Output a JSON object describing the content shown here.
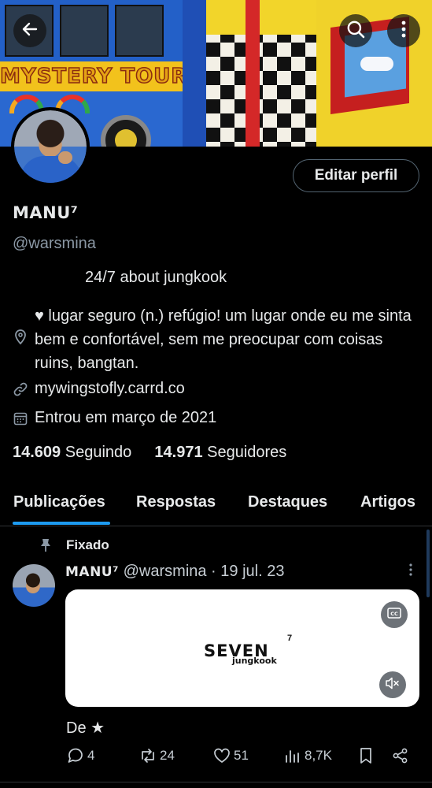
{
  "header": {
    "back_icon": "arrow-left-icon",
    "search_icon": "search-icon",
    "more_icon": "more-vertical-icon",
    "banner_text": "MYSTERY TOUR"
  },
  "profile": {
    "edit_label": "Editar perfil",
    "name": "MANU⁷",
    "handle": "@warsmina",
    "bio_line1": "24/7 about jungkook",
    "bio_line2": "♥ lugar seguro (n.) refúgio! um lugar onde eu me sinta bem e confortável, sem me preocupar com coisas ruins, bangtan.",
    "link": "mywingstofly.carrd.co",
    "joined": "Entrou em março de 2021",
    "following_count": "14.609",
    "following_label": "Seguindo",
    "followers_count": "14.971",
    "followers_label": "Seguidores"
  },
  "tabs": [
    {
      "label": "Publicações",
      "active": true
    },
    {
      "label": "Respostas",
      "active": false
    },
    {
      "label": "Destaques",
      "active": false
    },
    {
      "label": "Artigos",
      "active": false
    }
  ],
  "tweet": {
    "pinned_label": "Fixado",
    "author_name": "MANU⁷",
    "author_handle_date": "@warsmina · 19 jul. 23",
    "media_title": "SEVEN",
    "media_sup": "7",
    "media_sub": "jungkook",
    "text": "De ★",
    "replies": "4",
    "retweets": "24",
    "likes": "51",
    "views": "8,7K"
  },
  "colors": {
    "background": "#000000",
    "text": "#e7e9ea",
    "muted": "#8b98a5",
    "accent": "#1d9bf0",
    "border": "#2f3336"
  }
}
